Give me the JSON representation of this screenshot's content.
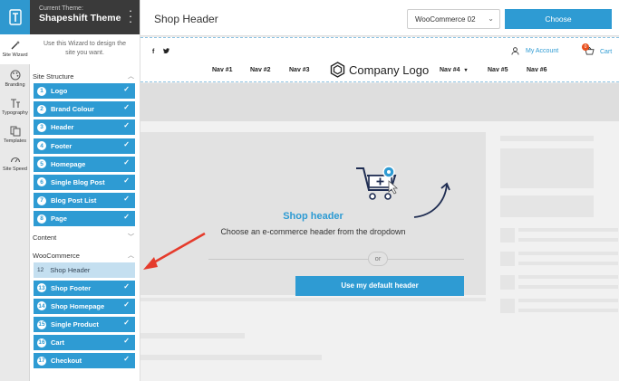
{
  "rail": {
    "items": [
      {
        "label": "Site Wizard",
        "icon": "magic-wand-icon"
      },
      {
        "label": "Branding",
        "icon": "palette-icon"
      },
      {
        "label": "Typography",
        "icon": "typography-icon"
      },
      {
        "label": "Templates",
        "icon": "templates-icon"
      },
      {
        "label": "Site Speed",
        "icon": "speedometer-icon"
      }
    ]
  },
  "panel": {
    "current_theme_label": "Current Theme:",
    "theme_name": "Shapeshift Theme",
    "intro": "Use this Wizard to design the site you want.",
    "site_structure_heading": "Site Structure",
    "site_structure": [
      {
        "num": "1",
        "label": "Logo"
      },
      {
        "num": "2",
        "label": "Brand Colour"
      },
      {
        "num": "3",
        "label": "Header"
      },
      {
        "num": "4",
        "label": "Footer"
      },
      {
        "num": "5",
        "label": "Homepage"
      },
      {
        "num": "6",
        "label": "Single Blog Post"
      },
      {
        "num": "7",
        "label": "Blog Post List"
      },
      {
        "num": "8",
        "label": "Page"
      }
    ],
    "content_heading": "Content",
    "woocommerce_heading": "WooCommerce",
    "woocommerce": [
      {
        "num": "12",
        "label": "Shop Header"
      },
      {
        "num": "13",
        "label": "Shop Footer"
      },
      {
        "num": "14",
        "label": "Shop Homepage"
      },
      {
        "num": "15",
        "label": "Single Product"
      },
      {
        "num": "16",
        "label": "Cart"
      },
      {
        "num": "17",
        "label": "Checkout"
      }
    ]
  },
  "topbar": {
    "title": "Shop Header",
    "select_value": "WooCommerce 02",
    "choose_label": "Choose"
  },
  "preview_header": {
    "social": [
      "f",
      "𝕥"
    ],
    "account_label": "My Account",
    "cart_label": "Cart",
    "cart_count": "0",
    "nav_left": [
      "Nav #1",
      "Nav #2",
      "Nav #3"
    ],
    "logo_text": "Company Logo",
    "nav_right": [
      "Nav #4",
      "Nav #5",
      "Nav #6"
    ]
  },
  "placeholder": {
    "heading": "Shop header",
    "description": "Choose an e-commerce header from the dropdown",
    "or_label": "or",
    "default_button": "Use my default header"
  },
  "colors": {
    "accent": "#2e9bd3",
    "current_step": "#c4dff0",
    "annotation_arrow": "#e53b2c",
    "badge": "#e84e1b"
  }
}
